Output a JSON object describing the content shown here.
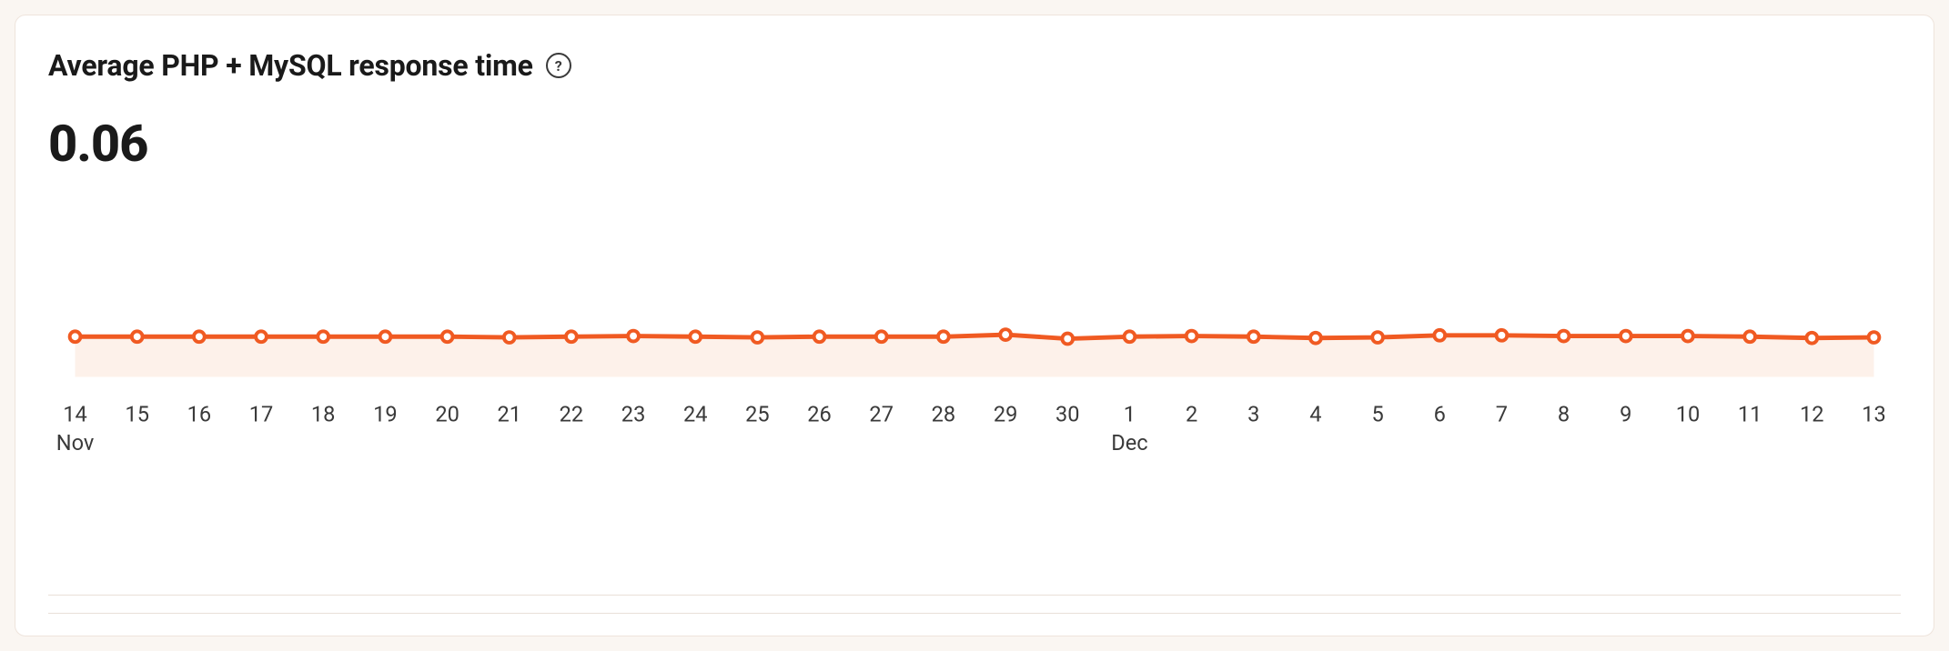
{
  "header": {
    "title": "Average PHP + MySQL response time",
    "help_tooltip": "?"
  },
  "metric": {
    "value": "0.06"
  },
  "colors": {
    "line": "#f05a22",
    "area": "#fdf1ea",
    "marker_fill": "#ffffff"
  },
  "x_axis": {
    "ticks": [
      "14",
      "15",
      "16",
      "17",
      "18",
      "19",
      "20",
      "21",
      "22",
      "23",
      "24",
      "25",
      "26",
      "27",
      "28",
      "29",
      "30",
      "1",
      "2",
      "3",
      "4",
      "5",
      "6",
      "7",
      "8",
      "9",
      "10",
      "11",
      "12",
      "13"
    ],
    "month_labels": {
      "0": "Nov",
      "17": "Dec"
    }
  },
  "chart_data": {
    "type": "line",
    "title": "Average PHP + MySQL response time",
    "xlabel": "",
    "ylabel": "",
    "ylim": [
      0,
      0.2
    ],
    "categories": [
      "Nov 14",
      "Nov 15",
      "Nov 16",
      "Nov 17",
      "Nov 18",
      "Nov 19",
      "Nov 20",
      "Nov 21",
      "Nov 22",
      "Nov 23",
      "Nov 24",
      "Nov 25",
      "Nov 26",
      "Nov 27",
      "Nov 28",
      "Nov 29",
      "Nov 30",
      "Dec 1",
      "Dec 2",
      "Dec 3",
      "Dec 4",
      "Dec 5",
      "Dec 6",
      "Dec 7",
      "Dec 8",
      "Dec 9",
      "Dec 10",
      "Dec 11",
      "Dec 12",
      "Dec 13"
    ],
    "values": [
      0.06,
      0.06,
      0.06,
      0.06,
      0.06,
      0.06,
      0.06,
      0.059,
      0.06,
      0.061,
      0.06,
      0.059,
      0.06,
      0.06,
      0.06,
      0.063,
      0.057,
      0.06,
      0.061,
      0.06,
      0.058,
      0.059,
      0.062,
      0.062,
      0.061,
      0.061,
      0.061,
      0.06,
      0.058,
      0.059
    ]
  }
}
